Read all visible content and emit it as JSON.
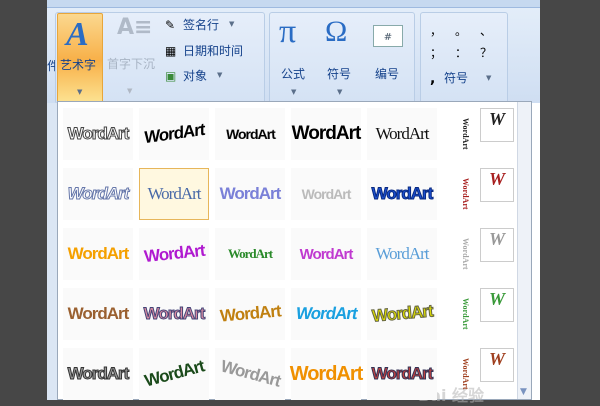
{
  "ribbon": {
    "wordart_label": "艺术字",
    "dropcap_label": "首字下沉",
    "signature_label": "签名行",
    "datetime_label": "日期和时间",
    "object_label": "对象",
    "equation_label": "公式",
    "symbol_label": "符号",
    "number_label": "编号",
    "special_symbol_label": "符号",
    "punctuation": [
      "，",
      "。",
      "、",
      "；",
      "：",
      "？"
    ],
    "cut_label": "件"
  },
  "gallery": {
    "sample_text": "WordArt",
    "vertical_sample": "WordArt",
    "w_sample": "W",
    "selected": [
      1,
      1
    ]
  },
  "watermark": "Bai 经验"
}
